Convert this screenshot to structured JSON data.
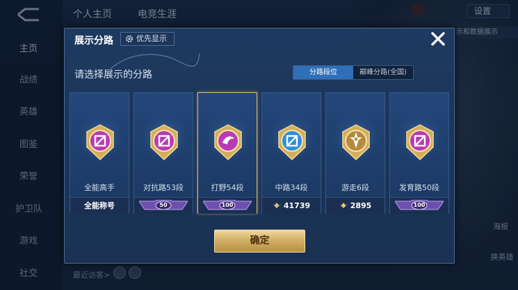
{
  "background": {
    "left_nav": [
      "主页",
      "战绩",
      "英雄",
      "图鉴",
      "荣誉",
      "护卫队",
      "游戏",
      "社交"
    ],
    "top_tabs": [
      "个人主页",
      "电竞生涯"
    ],
    "settings_label": "设置",
    "data_display_label": "示和数据展示",
    "poster_label": "海报",
    "hero_label": "换英雄",
    "recent_visitors_label": "最近访客>"
  },
  "modal": {
    "title": "展示分路",
    "priority_label": "优先显示",
    "subtitle": "请选择展示的分路",
    "toggle": {
      "options": [
        "分路段位",
        "巅峰分路(全国)"
      ],
      "selected": "分路段位"
    },
    "cards": [
      {
        "name": "全能高手",
        "bar_text": "全能称号",
        "bar_type": "text",
        "emblem": "all-round",
        "color": "#b83ab5"
      },
      {
        "name": "对抗路53段",
        "bar_text": "50",
        "bar_type": "badge",
        "emblem": "clash-lane",
        "color": "#b83ab5"
      },
      {
        "name": "打野54段",
        "bar_text": "100",
        "bar_type": "badge",
        "emblem": "jungle",
        "color": "#b83ab5",
        "selected": true
      },
      {
        "name": "中路34段",
        "bar_text": "41739",
        "bar_type": "score",
        "emblem": "mid-lane",
        "color": "#2a8fe0"
      },
      {
        "name": "游走6段",
        "bar_text": "2895",
        "bar_type": "score",
        "emblem": "roam",
        "color": "#b58a3c"
      },
      {
        "name": "发育路50段",
        "bar_text": "100",
        "bar_type": "badge",
        "emblem": "farm-lane",
        "color": "#b83ab5"
      }
    ],
    "confirm_label": "确定"
  },
  "colors": {
    "modal_bg": "#1f3a60",
    "toggle_active": "#2e6fb8",
    "confirm_gold": "#d2b068",
    "selected_border": "#d8b878"
  }
}
